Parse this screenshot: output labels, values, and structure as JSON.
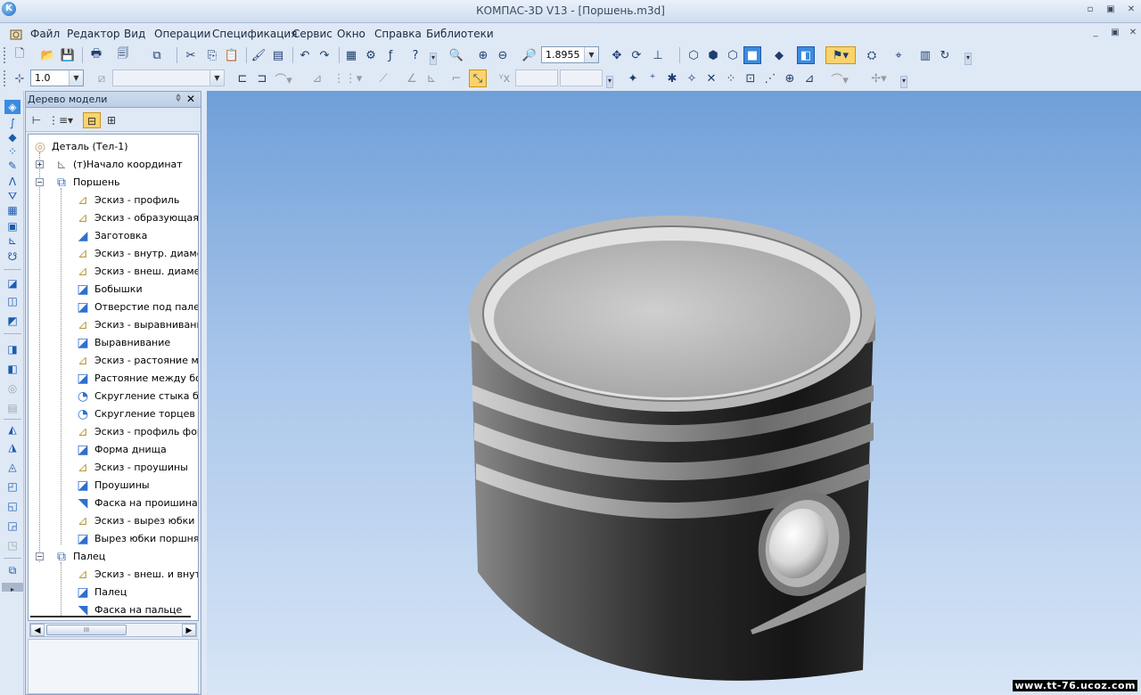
{
  "window": {
    "title": "КОМПАС-3D V13 - [Поршень.m3d]",
    "app_icon": "kompas-logo-icon",
    "minimize_label": "▫",
    "restore_label": "▣",
    "close_label": "✕"
  },
  "menu": {
    "items": [
      "Файл",
      "Редактор",
      "Вид",
      "Операции",
      "Спецификация",
      "Сервис",
      "Окно",
      "Справка",
      "Библиотеки"
    ],
    "mdi_minimize": "_",
    "mdi_restore": "▣",
    "mdi_close": "✕"
  },
  "toolbar": {
    "zoom_value": "1.8955"
  },
  "toolbar2": {
    "step_value": "1.0",
    "layer_value": "",
    "coord_x_value": "",
    "coord_y_value": ""
  },
  "tree_panel": {
    "title": "Дерево модели",
    "pin_label": "ᛰ",
    "close_label": "✕",
    "scroll_thumb_label": "III",
    "items": [
      {
        "label": "Деталь (Тел-1)",
        "level": 0,
        "icon": "part-icon"
      },
      {
        "label": "(т)Начало координат",
        "level": 1,
        "icon": "origin-axes-icon",
        "expander": "+"
      },
      {
        "label": "Поршень",
        "level": 1,
        "icon": "body-group-icon",
        "expander": "−"
      },
      {
        "label": "Эскиз - профиль",
        "level": 2,
        "icon": "sketch-icon"
      },
      {
        "label": "Эскиз - образующая",
        "level": 2,
        "icon": "sketch-icon"
      },
      {
        "label": "Заготовка",
        "level": 2,
        "icon": "revolve-icon"
      },
      {
        "label": "Эскиз - внутр. диаметр",
        "level": 2,
        "icon": "sketch-icon"
      },
      {
        "label": "Эскиз - внеш. диаметр",
        "level": 2,
        "icon": "sketch-icon"
      },
      {
        "label": "Бобышки",
        "level": 2,
        "icon": "extrude-icon"
      },
      {
        "label": "Отверстие под палец",
        "level": 2,
        "icon": "extrude-icon"
      },
      {
        "label": "Эскиз - выравнивание",
        "level": 2,
        "icon": "sketch-icon"
      },
      {
        "label": "Выравнивание",
        "level": 2,
        "icon": "extrude-icon"
      },
      {
        "label": "Эскиз - растояние между",
        "level": 2,
        "icon": "sketch-icon"
      },
      {
        "label": "Растояние между бобышками",
        "level": 2,
        "icon": "extrude-icon"
      },
      {
        "label": "Скругление стыка бобышек",
        "level": 2,
        "icon": "fillet-icon"
      },
      {
        "label": "Скругление торцев",
        "level": 2,
        "icon": "fillet-icon"
      },
      {
        "label": "Эскиз - профиль формы",
        "level": 2,
        "icon": "sketch-icon"
      },
      {
        "label": "Форма днища",
        "level": 2,
        "icon": "extrude-icon"
      },
      {
        "label": "Эскиз - проушины",
        "level": 2,
        "icon": "sketch-icon"
      },
      {
        "label": "Проушины",
        "level": 2,
        "icon": "extrude-icon"
      },
      {
        "label": "Фаска на проишинах",
        "level": 2,
        "icon": "chamfer-icon"
      },
      {
        "label": "Эскиз - вырез юбки поршня",
        "level": 2,
        "icon": "sketch-icon"
      },
      {
        "label": "Вырез юбки поршня",
        "level": 2,
        "icon": "extrude-icon"
      },
      {
        "label": "Палец",
        "level": 1,
        "icon": "body-group-icon",
        "expander": "−"
      },
      {
        "label": "Эскиз - внеш. и внутр.",
        "level": 2,
        "icon": "sketch-icon"
      },
      {
        "label": "Палец",
        "level": 2,
        "icon": "extrude-icon"
      },
      {
        "label": "Фаска на пальце",
        "level": 2,
        "icon": "chamfer-icon"
      }
    ]
  },
  "watermark": "www.tt-76.ucoz.com",
  "colors": {
    "highlight": "#fbd36a",
    "viewport_top": "#6f9fd8",
    "viewport_bottom": "#d7e5f6"
  }
}
